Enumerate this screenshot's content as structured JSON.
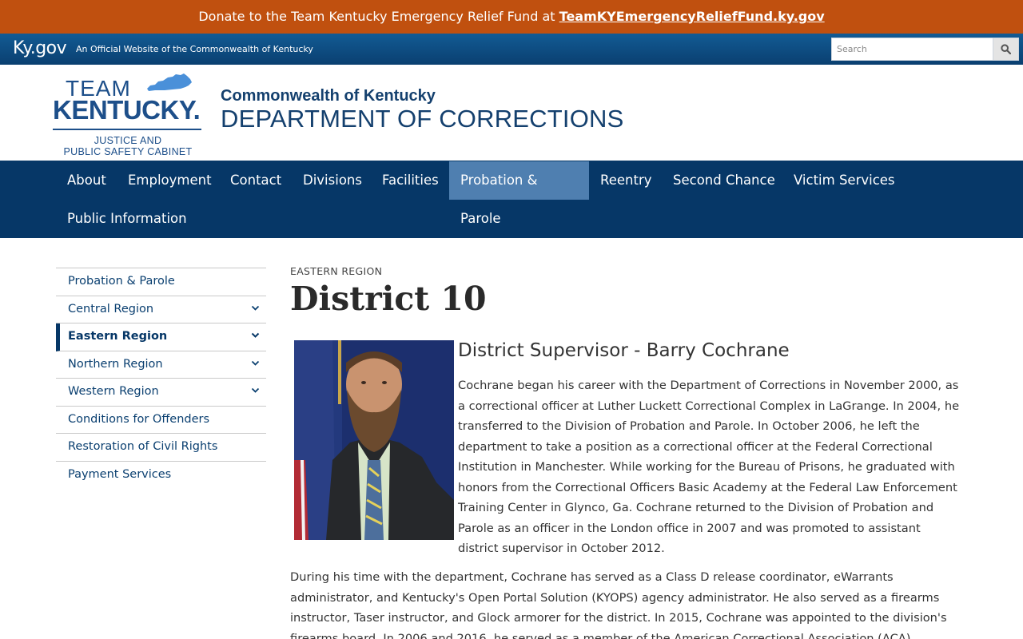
{
  "alert": {
    "text": "Donate to the Team Kentucky Emergency Relief Fund at ",
    "link": "TeamKYEmergencyReliefFund.ky.gov"
  },
  "kygov": {
    "logo": "Ky.gov",
    "tagline": "An Official Website of the Commonwealth of Kentucky",
    "search_placeholder": "Search",
    "search_icon": "search-icon"
  },
  "header": {
    "logo_team": "TEAM",
    "logo_kentucky": "KENTUCKY.",
    "logo_cabinet_line1": "JUSTICE AND",
    "logo_cabinet_line2": "PUBLIC SAFETY CABINET",
    "subtitle": "Commonwealth of Kentucky",
    "title": "DEPARTMENT OF CORRECTIONS"
  },
  "nav": {
    "items": [
      {
        "label": "About"
      },
      {
        "label": "Employment"
      },
      {
        "label": "Contact"
      },
      {
        "label": "Divisions"
      },
      {
        "label": "Facilities"
      },
      {
        "label": "Probation & Parole"
      },
      {
        "label": "Reentry"
      },
      {
        "label": "Second Chance"
      },
      {
        "label": "Victim Services"
      },
      {
        "label": "Public Information"
      }
    ],
    "active": "Probation & Parole"
  },
  "sidebar": {
    "items": [
      {
        "label": "Probation & Parole"
      },
      {
        "label": "Central Region"
      },
      {
        "label": "Eastern Region"
      },
      {
        "label": "Northern Region"
      },
      {
        "label": "Western Region"
      },
      {
        "label": "Conditions for Offenders"
      },
      {
        "label": "Restoration of Civil Rights"
      },
      {
        "label": "Payment Services"
      }
    ],
    "current": "Eastern Region"
  },
  "content": {
    "eyebrow": "EASTERN REGION",
    "title": "District 10",
    "subhead": "District Supervisor - Barry Cochrane",
    "bio_paragraph_1": "Cochrane began his career with the Department of Corrections in  November 2000, as a correctional officer at Luther Luckett Correctional Complex in LaGrange. In 2004, he transferred to the Division of Probation and Parole. In October 2006, he left the department to take a position as a correctional officer at the Federal Correctional Institution in Manchester. While working for the Bureau of Prisons, he graduated with honors from the Correctional Officers Basic Academy at the Federal Law Enforcement Training Center in Glynco, Ga. Cochrane returned to the Division of Probation and Parole as an officer in the London office in 2007 and was promoted to assistant district supervisor in October 2012.",
    "bio_paragraph_2": "During his time with the department, Cochrane has served as a Class D release coordinator, eWarrants administrator, and Kentucky's Open Portal Solution (KYOPS) agency administrator. He also served as a firearms instructor, Taser instructor, and Glock armorer for the district. In 2015, Cochrane was appointed to the division's firearms board. In 2006 and 2016, he served as a member of the American Correctional Association (ACA) compliance review team for the"
  },
  "colors": {
    "alert_bg": "#c0500f",
    "kygov_bar": "#0a3f70",
    "nav_bg": "#063767",
    "nav_active": "#4f7fb0",
    "brand_blue": "#1d4f8a"
  }
}
